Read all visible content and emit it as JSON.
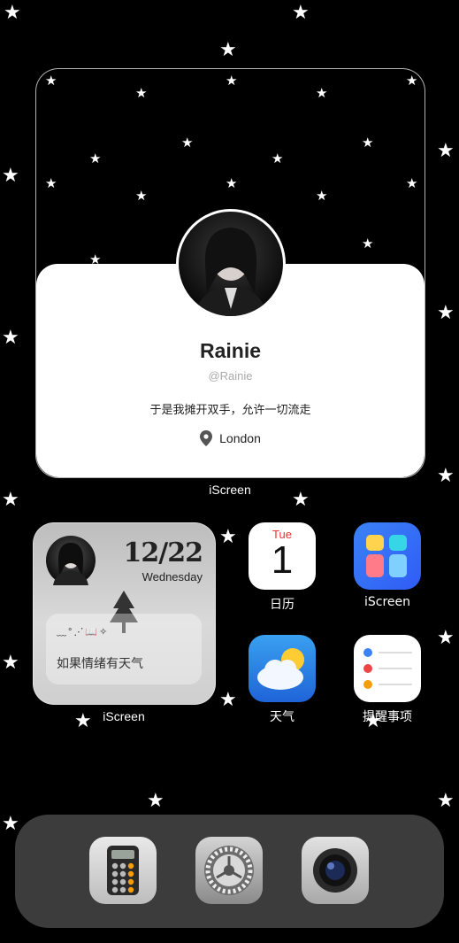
{
  "profile": {
    "name": "Rainie",
    "handle": "@Rainie",
    "bio": "于是我摊开双手，允许一切流走",
    "location": "London",
    "widget_label": "iScreen"
  },
  "date_widget": {
    "date": "12/22",
    "weekday": "Wednesday",
    "emoji_line": "﹏°⋰📖✧",
    "caption": "如果情绪有天气",
    "widget_label": "iScreen"
  },
  "apps": {
    "calendar": {
      "label": "日历",
      "weekday": "Tue",
      "day": "1"
    },
    "iscreen": {
      "label": "iScreen"
    },
    "weather": {
      "label": "天气"
    },
    "reminders": {
      "label": "提醒事项"
    }
  },
  "dock": {
    "items": [
      "calculator",
      "settings",
      "camera"
    ]
  },
  "colors": {
    "background": "#000000",
    "card": "#ffffff",
    "calendar_red": "#e33333",
    "iscreen_blue": "#2f5cf5"
  }
}
